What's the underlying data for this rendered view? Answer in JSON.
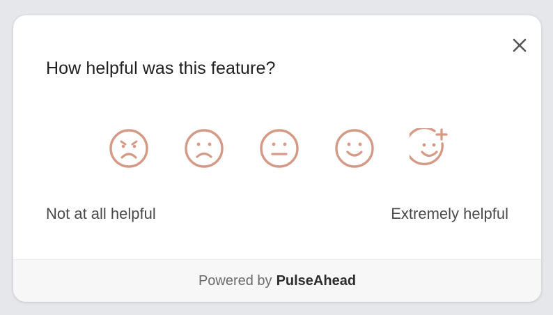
{
  "survey": {
    "question": "How helpful was this feature?",
    "scale_low_label": "Not at all helpful",
    "scale_high_label": "Extremely helpful",
    "options": [
      {
        "icon": "very-sad-face-icon"
      },
      {
        "icon": "sad-face-icon"
      },
      {
        "icon": "neutral-face-icon"
      },
      {
        "icon": "happy-face-icon"
      },
      {
        "icon": "very-happy-face-plus-icon"
      }
    ],
    "close_icon": "close-icon"
  },
  "footer": {
    "prefix": "Powered by",
    "brand": "PulseAhead"
  },
  "colors": {
    "face_stroke": "#d49a85",
    "background": "#e6e7ea",
    "card": "#ffffff",
    "footer_bg": "#f7f7f7"
  }
}
